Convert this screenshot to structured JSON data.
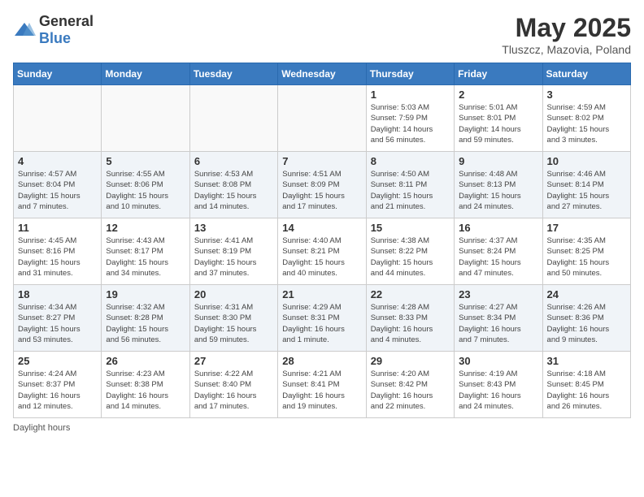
{
  "header": {
    "logo_general": "General",
    "logo_blue": "Blue",
    "month": "May 2025",
    "location": "Tluszcz, Mazovia, Poland"
  },
  "days_of_week": [
    "Sunday",
    "Monday",
    "Tuesday",
    "Wednesday",
    "Thursday",
    "Friday",
    "Saturday"
  ],
  "weeks": [
    [
      {
        "day": "",
        "info": ""
      },
      {
        "day": "",
        "info": ""
      },
      {
        "day": "",
        "info": ""
      },
      {
        "day": "",
        "info": ""
      },
      {
        "day": "1",
        "info": "Sunrise: 5:03 AM\nSunset: 7:59 PM\nDaylight: 14 hours\nand 56 minutes."
      },
      {
        "day": "2",
        "info": "Sunrise: 5:01 AM\nSunset: 8:01 PM\nDaylight: 14 hours\nand 59 minutes."
      },
      {
        "day": "3",
        "info": "Sunrise: 4:59 AM\nSunset: 8:02 PM\nDaylight: 15 hours\nand 3 minutes."
      }
    ],
    [
      {
        "day": "4",
        "info": "Sunrise: 4:57 AM\nSunset: 8:04 PM\nDaylight: 15 hours\nand 7 minutes."
      },
      {
        "day": "5",
        "info": "Sunrise: 4:55 AM\nSunset: 8:06 PM\nDaylight: 15 hours\nand 10 minutes."
      },
      {
        "day": "6",
        "info": "Sunrise: 4:53 AM\nSunset: 8:08 PM\nDaylight: 15 hours\nand 14 minutes."
      },
      {
        "day": "7",
        "info": "Sunrise: 4:51 AM\nSunset: 8:09 PM\nDaylight: 15 hours\nand 17 minutes."
      },
      {
        "day": "8",
        "info": "Sunrise: 4:50 AM\nSunset: 8:11 PM\nDaylight: 15 hours\nand 21 minutes."
      },
      {
        "day": "9",
        "info": "Sunrise: 4:48 AM\nSunset: 8:13 PM\nDaylight: 15 hours\nand 24 minutes."
      },
      {
        "day": "10",
        "info": "Sunrise: 4:46 AM\nSunset: 8:14 PM\nDaylight: 15 hours\nand 27 minutes."
      }
    ],
    [
      {
        "day": "11",
        "info": "Sunrise: 4:45 AM\nSunset: 8:16 PM\nDaylight: 15 hours\nand 31 minutes."
      },
      {
        "day": "12",
        "info": "Sunrise: 4:43 AM\nSunset: 8:17 PM\nDaylight: 15 hours\nand 34 minutes."
      },
      {
        "day": "13",
        "info": "Sunrise: 4:41 AM\nSunset: 8:19 PM\nDaylight: 15 hours\nand 37 minutes."
      },
      {
        "day": "14",
        "info": "Sunrise: 4:40 AM\nSunset: 8:21 PM\nDaylight: 15 hours\nand 40 minutes."
      },
      {
        "day": "15",
        "info": "Sunrise: 4:38 AM\nSunset: 8:22 PM\nDaylight: 15 hours\nand 44 minutes."
      },
      {
        "day": "16",
        "info": "Sunrise: 4:37 AM\nSunset: 8:24 PM\nDaylight: 15 hours\nand 47 minutes."
      },
      {
        "day": "17",
        "info": "Sunrise: 4:35 AM\nSunset: 8:25 PM\nDaylight: 15 hours\nand 50 minutes."
      }
    ],
    [
      {
        "day": "18",
        "info": "Sunrise: 4:34 AM\nSunset: 8:27 PM\nDaylight: 15 hours\nand 53 minutes."
      },
      {
        "day": "19",
        "info": "Sunrise: 4:32 AM\nSunset: 8:28 PM\nDaylight: 15 hours\nand 56 minutes."
      },
      {
        "day": "20",
        "info": "Sunrise: 4:31 AM\nSunset: 8:30 PM\nDaylight: 15 hours\nand 59 minutes."
      },
      {
        "day": "21",
        "info": "Sunrise: 4:29 AM\nSunset: 8:31 PM\nDaylight: 16 hours\nand 1 minute."
      },
      {
        "day": "22",
        "info": "Sunrise: 4:28 AM\nSunset: 8:33 PM\nDaylight: 16 hours\nand 4 minutes."
      },
      {
        "day": "23",
        "info": "Sunrise: 4:27 AM\nSunset: 8:34 PM\nDaylight: 16 hours\nand 7 minutes."
      },
      {
        "day": "24",
        "info": "Sunrise: 4:26 AM\nSunset: 8:36 PM\nDaylight: 16 hours\nand 9 minutes."
      }
    ],
    [
      {
        "day": "25",
        "info": "Sunrise: 4:24 AM\nSunset: 8:37 PM\nDaylight: 16 hours\nand 12 minutes."
      },
      {
        "day": "26",
        "info": "Sunrise: 4:23 AM\nSunset: 8:38 PM\nDaylight: 16 hours\nand 14 minutes."
      },
      {
        "day": "27",
        "info": "Sunrise: 4:22 AM\nSunset: 8:40 PM\nDaylight: 16 hours\nand 17 minutes."
      },
      {
        "day": "28",
        "info": "Sunrise: 4:21 AM\nSunset: 8:41 PM\nDaylight: 16 hours\nand 19 minutes."
      },
      {
        "day": "29",
        "info": "Sunrise: 4:20 AM\nSunset: 8:42 PM\nDaylight: 16 hours\nand 22 minutes."
      },
      {
        "day": "30",
        "info": "Sunrise: 4:19 AM\nSunset: 8:43 PM\nDaylight: 16 hours\nand 24 minutes."
      },
      {
        "day": "31",
        "info": "Sunrise: 4:18 AM\nSunset: 8:45 PM\nDaylight: 16 hours\nand 26 minutes."
      }
    ]
  ],
  "footer": {
    "daylight_label": "Daylight hours"
  }
}
